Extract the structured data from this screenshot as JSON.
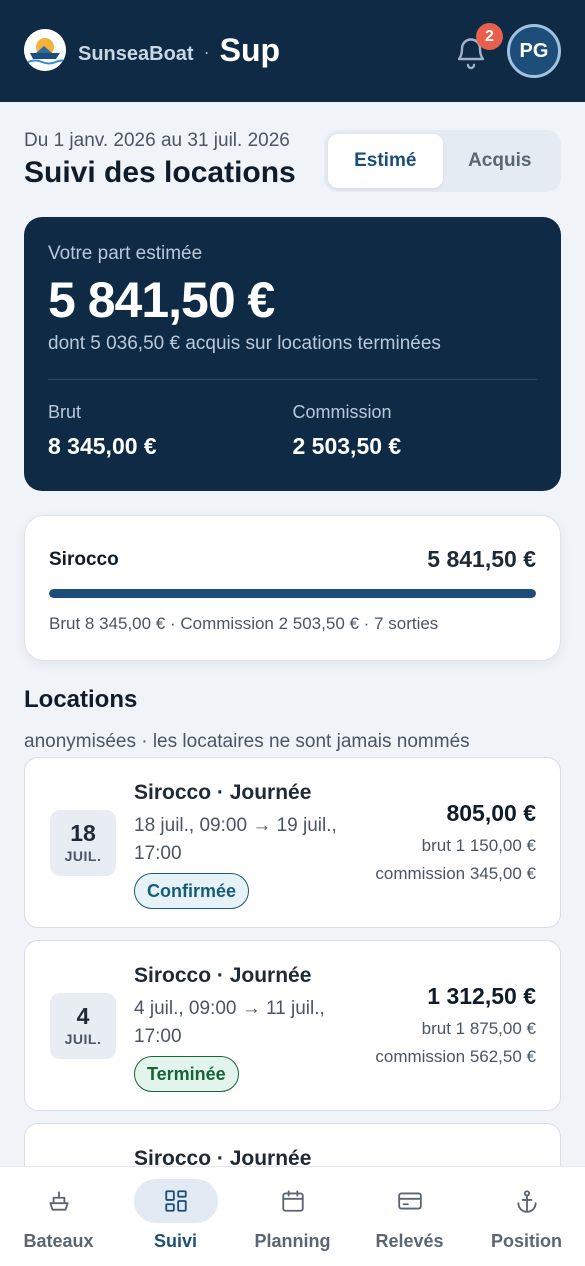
{
  "header": {
    "brand": "SunseaBoat",
    "separator": "·",
    "app_name": "Sup",
    "notification_count": "2",
    "avatar_initials": "PG"
  },
  "period": "Du 1 janv. 2026 au 31 juil. 2026",
  "title": "Suivi des locations",
  "toggle": {
    "estimated": "Estimé",
    "acquired": "Acquis",
    "selected": "Estimé"
  },
  "summary": {
    "label": "Votre part estimée",
    "amount": "5 841,50 €",
    "sub": "dont 5 036,50 € acquis sur locations terminées",
    "brut_label": "Brut",
    "brut_value": "8 345,00 €",
    "commission_label": "Commission",
    "commission_value": "2 503,50 €"
  },
  "boat": {
    "name": "Sirocco",
    "amount": "5 841,50 €",
    "progress": 1.0,
    "meta": "Brut 8 345,00 € · Commission 2 503,50 € · 7 sorties"
  },
  "locations": {
    "title": "Locations",
    "subtitle": "anonymisées · les locataires ne sont jamais nommés",
    "items": [
      {
        "day": "18",
        "month": "JUIL.",
        "name": "Sirocco · Journée",
        "dates": "18 juil., 09:00 → 19 juil., 17:00",
        "status": "Confirmée",
        "net": "805,00 €",
        "brut": "brut 1 150,00 €",
        "commission": "commission 345,00 €"
      },
      {
        "day": "4",
        "month": "JUIL.",
        "name": "Sirocco · Journée",
        "dates": "4 juil., 09:00 → 11 juil., 17:00",
        "status": "Terminée",
        "net": "1 312,50 €",
        "brut": "brut 1 875,00 €",
        "commission": "commission 562,50 €"
      },
      {
        "name": "Sirocco · Journée"
      }
    ]
  },
  "nav": {
    "items": [
      {
        "label": "Bateaux",
        "icon": "boat-icon"
      },
      {
        "label": "Suivi",
        "icon": "dashboard-icon"
      },
      {
        "label": "Planning",
        "icon": "calendar-icon"
      },
      {
        "label": "Relevés",
        "icon": "card-icon"
      },
      {
        "label": "Position",
        "icon": "anchor-icon"
      }
    ],
    "active": "Suivi"
  },
  "colors": {
    "navy": "#0f2a44",
    "accent": "#1d4e7a",
    "badge": "#e8604c",
    "background": "#f0f4f8"
  }
}
